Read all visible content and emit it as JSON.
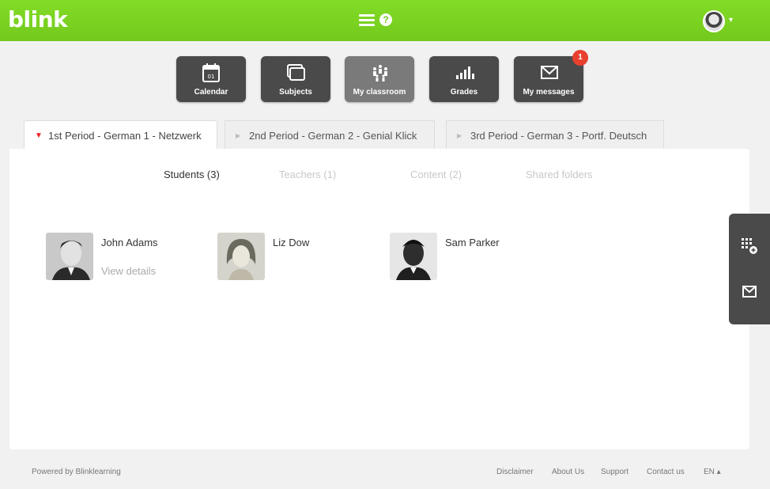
{
  "header": {
    "logo": "blink",
    "menu_icon": "hamburger-icon",
    "help_icon": "help-icon",
    "help_glyph": "?",
    "avatar_caret": "▾"
  },
  "apps": [
    {
      "label": "Calendar",
      "icon": "calendar-icon",
      "day": "01"
    },
    {
      "label": "Subjects",
      "icon": "subjects-icon"
    },
    {
      "label": "My classroom",
      "icon": "classroom-icon"
    },
    {
      "label": "Grades",
      "icon": "grades-icon"
    },
    {
      "label": "My messages",
      "icon": "envelope-icon",
      "badge": "1"
    }
  ],
  "period_tabs": [
    {
      "label": "1st Period - German 1 - Netzwerk",
      "active": true
    },
    {
      "label": "2nd Period - German 2 - Genial Klick",
      "active": false
    },
    {
      "label": "3rd Period - German 3 - Portf. Deutsch",
      "active": false
    }
  ],
  "sub_tabs": [
    {
      "label": "Students (3)",
      "active": true
    },
    {
      "label": "Teachers (1)",
      "active": false
    },
    {
      "label": "Content (2)",
      "active": false
    },
    {
      "label": "Shared folders",
      "active": false
    }
  ],
  "students": [
    {
      "name": "John Adams",
      "details": "View details"
    },
    {
      "name": "Liz Dow"
    },
    {
      "name": "Sam Parker"
    }
  ],
  "side_panel": {
    "top_icon": "grid-add-icon",
    "bottom_icon": "envelope-icon"
  },
  "footer": {
    "powered_by": "Powered by Blinklearning",
    "links": [
      "Disclaimer",
      "About Us",
      "Support",
      "Contact us",
      "EN ▴"
    ]
  },
  "colors": {
    "brand_green": "#7ed321",
    "dark_tile": "#4a4a4a",
    "badge_red": "#e8402f",
    "active_arrow": "#e22222"
  }
}
